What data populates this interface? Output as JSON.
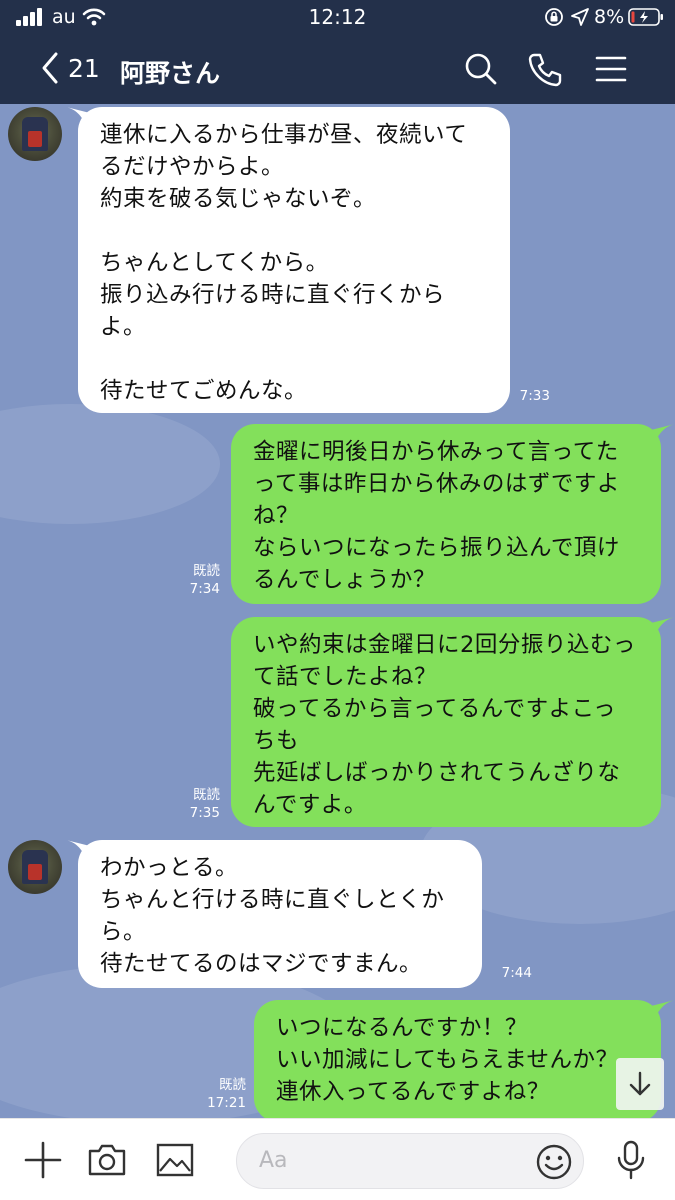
{
  "status_bar": {
    "carrier": "au",
    "time": "12:12",
    "battery": "8%"
  },
  "header": {
    "back_count": "21",
    "title": "阿野さん"
  },
  "messages": [
    {
      "direction": "in",
      "text": "連休に入るから仕事が昼、夜続いてるだけやからよ。\n約束を破る気じゃないぞ。\n\nちゃんとしてくから。\n振り込み行ける時に直ぐ行くからよ。\n\n待たせてごめんな。",
      "time": "7:33"
    },
    {
      "direction": "out",
      "text": "金曜に明後日から休みって言ってたって事は昨日から休みのはずですよね？\nならいつになったら振り込んで頂けるんでしょうか？",
      "read": "既読",
      "time": "7:34"
    },
    {
      "direction": "out",
      "text": "いや約束は金曜日に2回分振り込むって話でしたよね？\n破ってるから言ってるんですよこっちも\n先延ばしばっかりされてうんざりなんですよ。",
      "read": "既読",
      "time": "7:35"
    },
    {
      "direction": "in",
      "text": "わかっとる。\nちゃんと行ける時に直ぐしとくから。\n待たせてるのはマジですまん。",
      "time": "7:44"
    },
    {
      "direction": "out",
      "text": "いつになるんですか！？\nいい加減にしてもらえませんか？\n連休入ってるんですよね？",
      "read": "既読",
      "time": "17:21"
    }
  ],
  "input": {
    "placeholder": "Aa"
  },
  "icons": {
    "status": [
      "signal-icon",
      "wifi-icon",
      "orientation-lock-icon",
      "location-icon",
      "battery-icon"
    ],
    "header": [
      "back-chevron-icon",
      "search-icon",
      "phone-icon",
      "menu-icon"
    ],
    "input": [
      "plus-icon",
      "camera-icon",
      "image-icon",
      "smile-icon",
      "microphone-icon"
    ],
    "chat": [
      "scroll-down-arrow-icon"
    ]
  },
  "colors": {
    "header_bg": "#23304a",
    "chat_bg": "#8196c4",
    "outgoing_bubble": "#83e05b",
    "incoming_bubble": "#ffffff",
    "battery_low": "#e8473f"
  }
}
